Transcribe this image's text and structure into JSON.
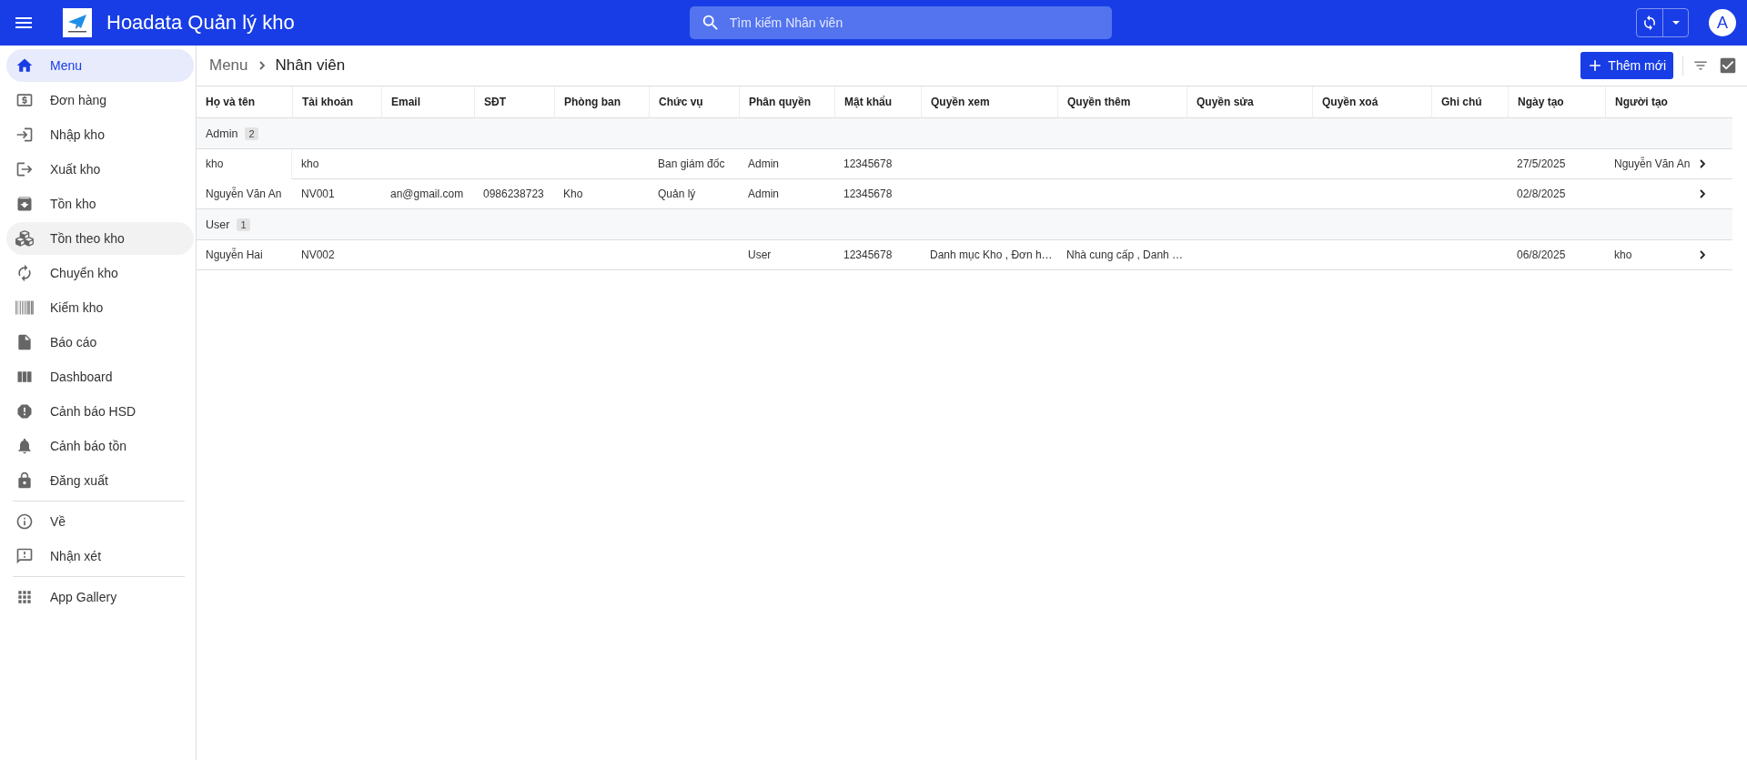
{
  "app_bar": {
    "title": "Hoadata Quản lý kho",
    "search": {
      "placeholder": "Tìm kiếm Nhân viên"
    },
    "avatar": "A"
  },
  "sidebar": {
    "sections": [
      [
        {
          "label": "Menu",
          "selected": true,
          "hovered": false
        },
        {
          "label": "Đơn hàng",
          "selected": false,
          "hovered": false
        },
        {
          "label": "Nhập kho",
          "selected": false,
          "hovered": false
        },
        {
          "label": "Xuất kho",
          "selected": false,
          "hovered": false
        },
        {
          "label": "Tồn kho",
          "selected": false,
          "hovered": false
        },
        {
          "label": "Tồn theo kho",
          "selected": false,
          "hovered": true
        },
        {
          "label": "Chuyển kho",
          "selected": false,
          "hovered": false
        },
        {
          "label": "Kiểm kho",
          "selected": false,
          "hovered": false
        },
        {
          "label": "Báo cáo",
          "selected": false,
          "hovered": false
        },
        {
          "label": "Dashboard",
          "selected": false,
          "hovered": false
        },
        {
          "label": "Cảnh báo HSD",
          "selected": false,
          "hovered": false
        },
        {
          "label": "Cảnh báo tồn",
          "selected": false,
          "hovered": false
        },
        {
          "label": "Đăng xuất",
          "selected": false,
          "hovered": false
        }
      ],
      [
        {
          "label": "Về",
          "selected": false,
          "hovered": false
        },
        {
          "label": "Nhận xét",
          "selected": false,
          "hovered": false
        }
      ],
      [
        {
          "label": "App Gallery",
          "selected": false,
          "hovered": false
        }
      ]
    ]
  },
  "breadcrumb": [
    "Menu",
    "Nhân viên"
  ],
  "add_button": "Thêm mới",
  "table": {
    "columns": [
      "Họ và tên",
      "Tài khoản",
      "Email",
      "SĐT",
      "Phòng ban",
      "Chức vụ",
      "Phân quyền",
      "Mật khẩu",
      "Quyền xem",
      "Quyền thêm",
      "Quyền sửa",
      "Quyền xoá",
      "Ghi chú",
      "Ngày tạo",
      "Người tạo"
    ],
    "groups": [
      {
        "label": "Admin",
        "count": "2",
        "rows": [
          {
            "cells": [
              "kho",
              "kho",
              null,
              null,
              null,
              "Ban giám đốc",
              "Admin",
              "12345678",
              null,
              null,
              null,
              null,
              null,
              "27/5/2025",
              "Nguyễn Văn An"
            ]
          },
          {
            "cells": [
              "Nguyễn Văn An",
              "NV001",
              "an@gmail.com",
              "0986238723",
              "Kho",
              "Quản lý",
              "Admin",
              "12345678",
              null,
              null,
              null,
              null,
              null,
              "02/8/2025",
              null
            ]
          }
        ]
      },
      {
        "label": "User",
        "count": "1",
        "rows": [
          {
            "cells": [
              "Nguyễn Hai",
              "NV002",
              null,
              null,
              null,
              null,
              "User",
              "12345678",
              "Danh mục Kho , Đơn h…",
              "Nhà cung cấp , Danh …",
              null,
              null,
              null,
              "06/8/2025",
              "kho"
            ]
          }
        ]
      }
    ]
  }
}
